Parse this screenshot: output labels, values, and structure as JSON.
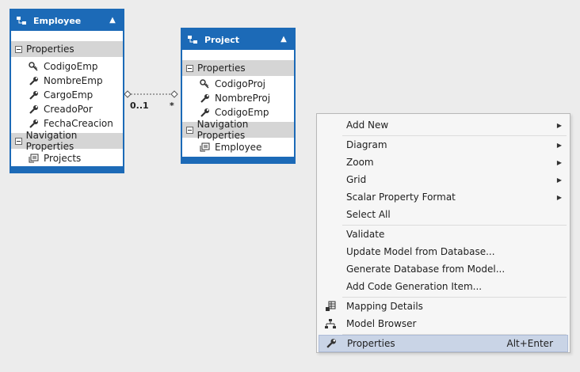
{
  "employee": {
    "title": "Employee",
    "properties_label": "Properties",
    "properties": [
      "CodigoEmp",
      "NombreEmp",
      "CargoEmp",
      "CreadoPor",
      "FechaCreacion"
    ],
    "nav_label": "Navigation Properties",
    "nav": [
      "Projects"
    ]
  },
  "project": {
    "title": "Project",
    "properties_label": "Properties",
    "properties": [
      "CodigoProj",
      "NombreProj",
      "CodigoEmp"
    ],
    "nav_label": "Navigation Properties",
    "nav": [
      "Employee"
    ]
  },
  "association": {
    "left": "0..1",
    "right": "*"
  },
  "menu": {
    "items": [
      {
        "label": "Add New",
        "submenu": true
      },
      {
        "label": "Diagram",
        "submenu": true
      },
      {
        "label": "Zoom",
        "submenu": true
      },
      {
        "label": "Grid",
        "submenu": true
      },
      {
        "label": "Scalar Property Format",
        "submenu": true
      },
      {
        "label": "Select All"
      },
      {
        "label": "Validate"
      },
      {
        "label": "Update Model from Database..."
      },
      {
        "label": "Generate Database from Model..."
      },
      {
        "label": "Add Code Generation Item..."
      },
      {
        "label": "Mapping Details",
        "icon": "mapping-details-icon"
      },
      {
        "label": "Model Browser",
        "icon": "model-browser-icon"
      },
      {
        "label": "Properties",
        "icon": "wrench-icon",
        "shortcut": "Alt+Enter",
        "highlighted": true
      }
    ]
  },
  "colors": {
    "entity": "#1c6ab7",
    "section": "#d5d5d5",
    "highlight": "#c9d4e6",
    "canvas": "#ececec"
  }
}
